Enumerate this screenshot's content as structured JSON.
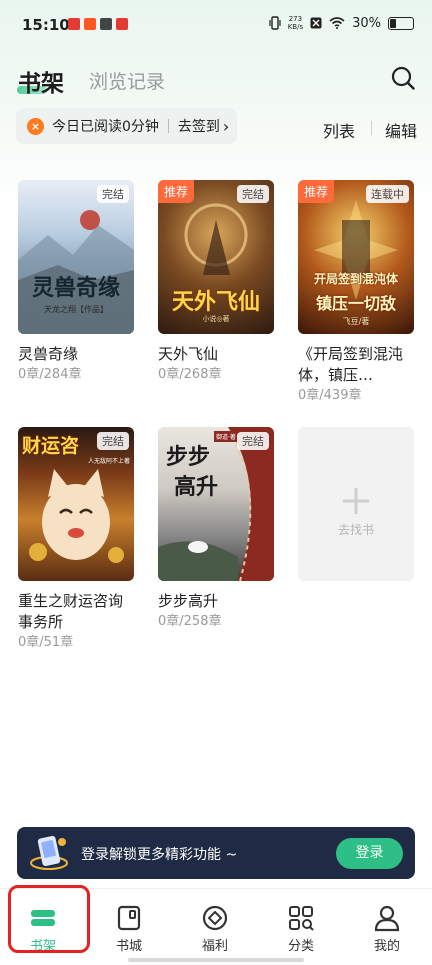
{
  "status_bar": {
    "time": "15:10",
    "net_speed": "273",
    "net_unit": "KB/s",
    "battery": "30%"
  },
  "header": {
    "tab_active": "书架",
    "tab_inactive": "浏览记录"
  },
  "reading": {
    "today_text": "今日已阅读0分钟",
    "checkin_label": "去签到"
  },
  "view": {
    "list_label": "列表",
    "edit_label": "编辑"
  },
  "books": [
    {
      "title": "灵兽奇缘",
      "progress": "0章/284章",
      "status": "完结",
      "recommend": "",
      "cover_text": "灵兽奇缘",
      "cover_author": "天龙之翔【作品】"
    },
    {
      "title": "天外飞仙",
      "progress": "0章/268章",
      "status": "完结",
      "recommend": "推荐",
      "cover_text": "天外飞仙",
      "cover_author": "小说◎著"
    },
    {
      "title": "《开局签到混沌体，镇压…",
      "progress": "0章/439章",
      "status": "连载中",
      "recommend": "推荐",
      "cover_text_1": "开局签到混沌体",
      "cover_text_2": "镇压一切敌",
      "cover_author": "飞豆/著"
    },
    {
      "title": "重生之财运咨询事务所",
      "progress": "0章/51章",
      "status": "完结",
      "recommend": "",
      "cover_text": "财运咨",
      "cover_author": "人无敌阿不上著"
    },
    {
      "title": "步步高升",
      "progress": "0章/258章",
      "status": "完结",
      "recommend": "",
      "cover_text_1": "步步",
      "cover_text_2": "高升",
      "cover_author": "御道·著"
    }
  ],
  "find_book": {
    "label": "去找书"
  },
  "login_banner": {
    "text": "登录解锁更多精彩功能 ~",
    "button": "登录"
  },
  "nav": [
    {
      "label": "书架",
      "icon": "bookshelf-icon",
      "active": true
    },
    {
      "label": "书城",
      "icon": "bookstore-icon",
      "active": false
    },
    {
      "label": "福利",
      "icon": "coin-icon",
      "active": false
    },
    {
      "label": "分类",
      "icon": "category-icon",
      "active": false
    },
    {
      "label": "我的",
      "icon": "profile-icon",
      "active": false
    }
  ],
  "colors": {
    "accent": "#2dbf85",
    "recommend_badge": "#ff6a3d",
    "banner_bg": "#1f2b44",
    "highlight_box": "#e52222"
  }
}
